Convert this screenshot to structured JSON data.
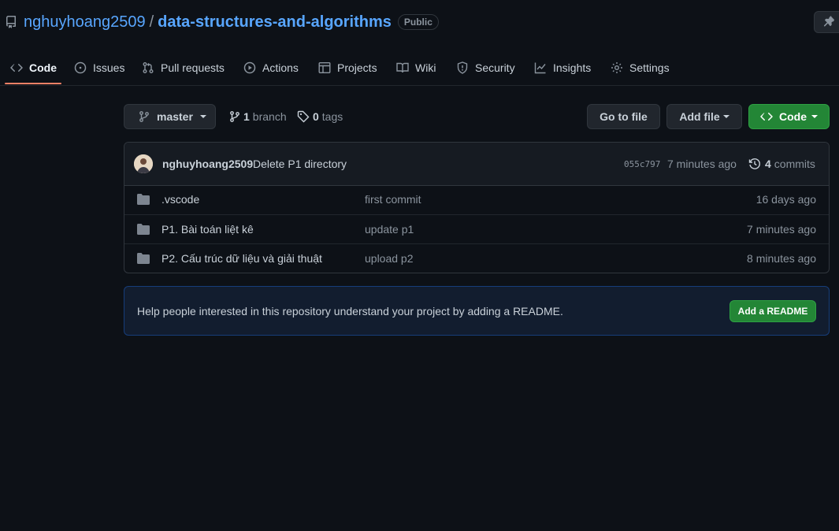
{
  "repo": {
    "owner": "nghuyhoang2509",
    "separator": "/",
    "name": "data-structures-and-algorithms",
    "visibility": "Public"
  },
  "tabs": [
    {
      "label": "Code",
      "icon": "code-icon"
    },
    {
      "label": "Issues",
      "icon": "issue-icon"
    },
    {
      "label": "Pull requests",
      "icon": "pull-request-icon"
    },
    {
      "label": "Actions",
      "icon": "play-icon"
    },
    {
      "label": "Projects",
      "icon": "table-icon"
    },
    {
      "label": "Wiki",
      "icon": "book-icon"
    },
    {
      "label": "Security",
      "icon": "shield-icon"
    },
    {
      "label": "Insights",
      "icon": "graph-icon"
    },
    {
      "label": "Settings",
      "icon": "gear-icon"
    }
  ],
  "toolbar": {
    "branch_name": "master",
    "branch_count": "1",
    "branch_label": "branch",
    "tag_count": "0",
    "tag_label": "tags",
    "go_to_file": "Go to file",
    "add_file": "Add file",
    "code": "Code"
  },
  "latest_commit": {
    "author": "nghuyhoang2509",
    "message": "Delete P1 directory",
    "sha": "055c797",
    "time": "7 minutes ago",
    "commit_count": "4",
    "commit_label": "commits"
  },
  "files": [
    {
      "name": ".vscode",
      "message": "first commit",
      "age": "16 days ago"
    },
    {
      "name": "P1. Bài toán liệt kê",
      "message": "update p1",
      "age": "7 minutes ago"
    },
    {
      "name": "P2. Cấu trúc dữ liệu và giải thuật",
      "message": "upload p2",
      "age": "8 minutes ago"
    }
  ],
  "readme_banner": {
    "text": "Help people interested in this repository understand your project by adding a README.",
    "button": "Add a README"
  },
  "colors": {
    "background": "#0d1117",
    "link": "#58a6ff",
    "accent_underline": "#f78166",
    "primary_button": "#238636"
  }
}
